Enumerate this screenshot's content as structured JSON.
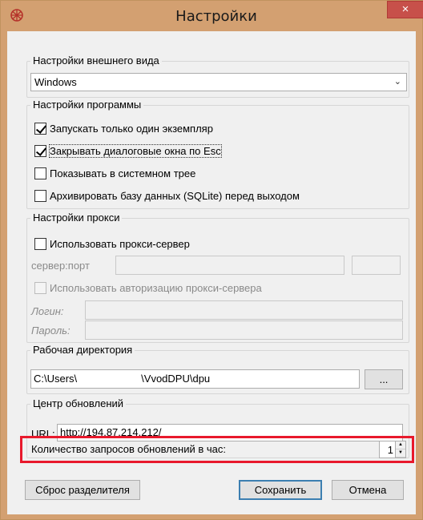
{
  "window": {
    "title": "Настройки",
    "close_glyph": "×",
    "accent_color": "#d3a071"
  },
  "appearance": {
    "title": "Настройки внешнего вида",
    "selected_style": "Windows"
  },
  "program": {
    "title": "Настройки программы",
    "options": [
      {
        "label": "Запускать только один экземпляр",
        "checked": true
      },
      {
        "label": "Закрывать диалоговые окна по Esc",
        "checked": true
      },
      {
        "label": "Показывать в системном трее",
        "checked": false
      },
      {
        "label": "Архивировать базу данных (SQLite) перед выходом",
        "checked": false
      }
    ]
  },
  "proxy": {
    "title": "Настройки прокси",
    "use_proxy_label": "Использовать прокси-сервер",
    "server_port_label": "сервер:порт",
    "use_auth_label": "Использовать авторизацию прокси-сервера",
    "login_label": "Логин:",
    "password_label": "Пароль:"
  },
  "workdir": {
    "title": "Рабочая директория",
    "path_prefix": "C:\\Users\\",
    "path_suffix": "\\VvodDPU\\dpu",
    "browse_label": "..."
  },
  "updates": {
    "title": "Центр обновлений",
    "url_label": "URL:",
    "url_value": "http://194.87.214.212/",
    "requests_label": "Количество запросов обновлений в час:",
    "requests_value": "1"
  },
  "buttons": {
    "reset_splitter": "Сброс разделителя",
    "save": "Сохранить",
    "cancel": "Отмена"
  },
  "colors": {
    "highlight": "#e8192c",
    "close_button": "#c7504a"
  }
}
